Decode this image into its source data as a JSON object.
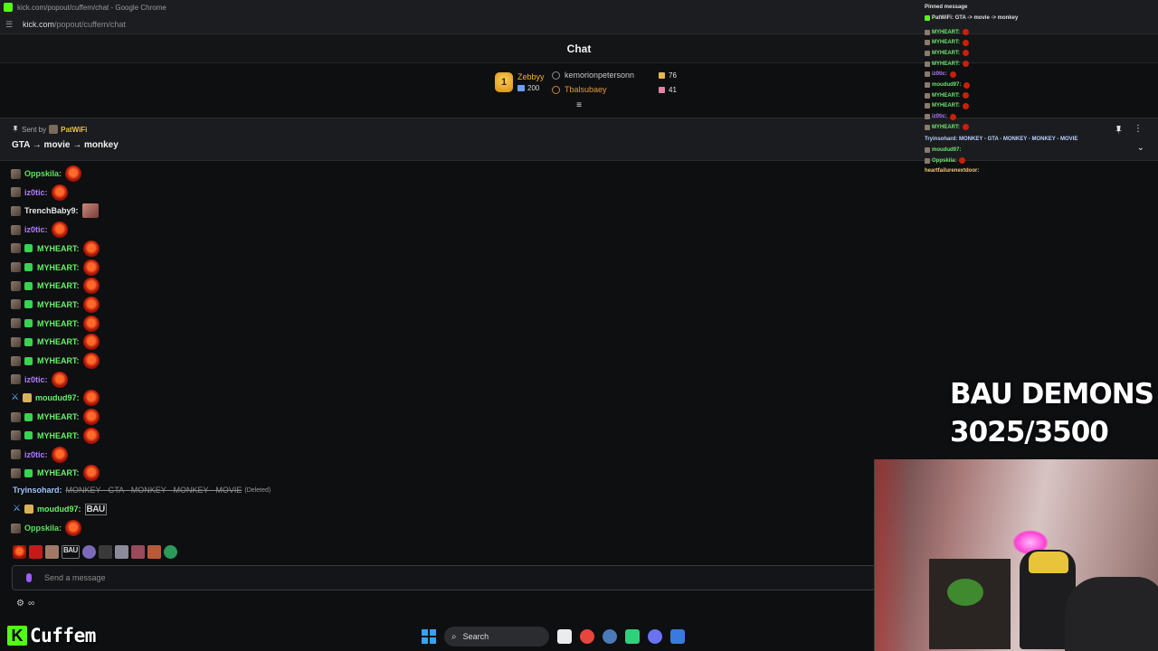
{
  "browser": {
    "title": "kick.com/popout/cuffem/chat - Google Chrome",
    "url_domain": "kick.com",
    "url_path": "/popout/cuffem/chat"
  },
  "chat_header": {
    "title": "Chat"
  },
  "leaderboard": {
    "rank_badge": "1",
    "top_name": "Zebbyy",
    "top_count": "200",
    "entries": [
      {
        "name": "kemorionpetersonn",
        "count": "76"
      },
      {
        "name": "Tbalsubaey",
        "count": "41"
      }
    ]
  },
  "pinned": {
    "sent_by_label": "Sent by",
    "sender": "PatWiFi",
    "message": "GTA → movie → monkey"
  },
  "messages": [
    {
      "user": "Oppskila:",
      "color": "#5ce25c",
      "emote": "heart"
    },
    {
      "user": "iz0tic:",
      "color": "#b27dff",
      "emote": "heart"
    },
    {
      "user": "TrenchBaby9:",
      "color": "#e8e8e8",
      "emote": "pic"
    },
    {
      "user": "iz0tic:",
      "color": "#b27dff",
      "emote": "heart"
    },
    {
      "user": "MYHEART:",
      "color": "#6af06a",
      "sub": true,
      "emote": "heart"
    },
    {
      "user": "MYHEART:",
      "color": "#6af06a",
      "sub": true,
      "emote": "heart"
    },
    {
      "user": "MYHEART:",
      "color": "#6af06a",
      "sub": true,
      "emote": "heart"
    },
    {
      "user": "MYHEART:",
      "color": "#6af06a",
      "sub": true,
      "emote": "heart"
    },
    {
      "user": "MYHEART:",
      "color": "#6af06a",
      "sub": true,
      "emote": "heart"
    },
    {
      "user": "MYHEART:",
      "color": "#6af06a",
      "sub": true,
      "emote": "heart"
    },
    {
      "user": "MYHEART:",
      "color": "#6af06a",
      "sub": true,
      "emote": "heart"
    },
    {
      "user": "iz0tic:",
      "color": "#b27dff",
      "emote": "heart"
    },
    {
      "user": "moudud97:",
      "color": "#6af06a",
      "mod": true,
      "emote": "heart"
    },
    {
      "user": "MYHEART:",
      "color": "#6af06a",
      "sub": true,
      "emote": "heart"
    },
    {
      "user": "MYHEART:",
      "color": "#6af06a",
      "sub": true,
      "emote": "heart"
    },
    {
      "user": "iz0tic:",
      "color": "#b27dff",
      "emote": "heart"
    },
    {
      "user": "MYHEART:",
      "color": "#6af06a",
      "sub": true,
      "emote": "heart"
    }
  ],
  "deleted_message": {
    "user": "Tryinsohard:",
    "text": "MONKEY - GTA - MONKEY - MONKEY - MOVIE",
    "tag": "(Deleted)"
  },
  "late_messages": [
    {
      "user": "moudud97:",
      "emote_text": "BAU"
    },
    {
      "user": "Oppskila:"
    }
  ],
  "emote_bar_bau": "BAU",
  "input": {
    "placeholder": "Send a message"
  },
  "bottom_icons": "∞",
  "overlay_chat": {
    "pinned_label": "Pinned message",
    "pinned_text": "PatWiFi: GTA -> movie -> monkey",
    "rows": [
      {
        "user": "MYHEART:"
      },
      {
        "user": "MYHEART:"
      },
      {
        "user": "MYHEART:"
      },
      {
        "user": "MYHEART:"
      },
      {
        "user": "iz0tic:"
      },
      {
        "user": "moudud97:"
      },
      {
        "user": "MYHEART:"
      },
      {
        "user": "MYHEART:"
      },
      {
        "user": "iz0tic:"
      },
      {
        "user": "MYHEART:"
      }
    ],
    "tryin_row": "Tryinsohard: MONKEY - GTA - MONKEY - MONKEY - MOVIE",
    "moudud_row": "moudud97:",
    "opps_row": "Oppskila:",
    "heart_row": "heartfailurenextdoor:"
  },
  "goal": {
    "line1": "BAU DEMONS",
    "line2": "3025/3500"
  },
  "channel": {
    "logo": "K",
    "name": "Cuffem"
  },
  "taskbar": {
    "search_label": "Search"
  },
  "colors": {
    "kick_green": "#53fc18",
    "accent_purple": "#a05cff"
  }
}
